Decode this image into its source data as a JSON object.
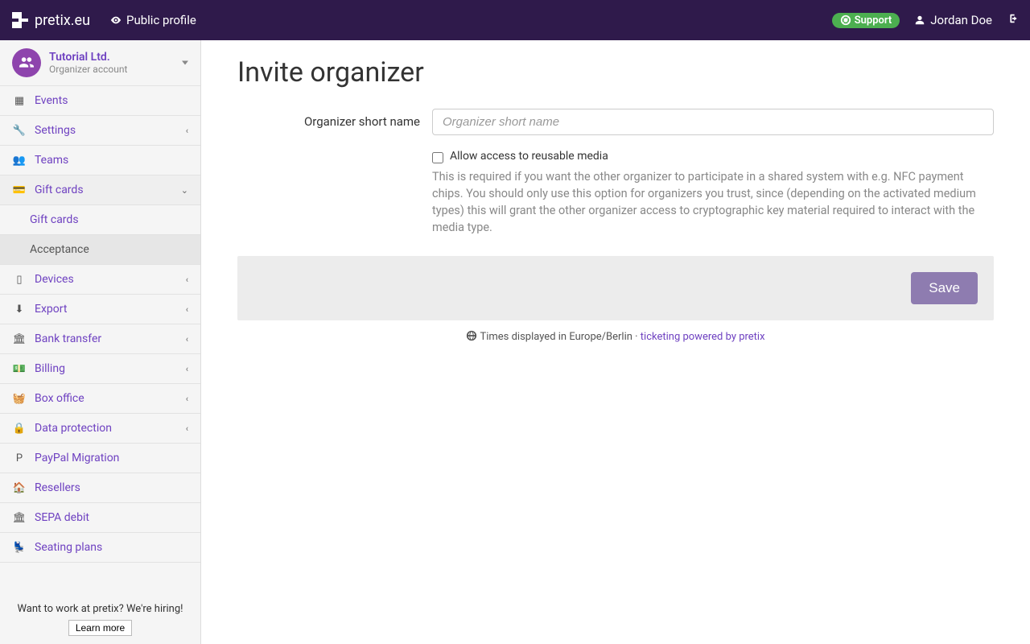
{
  "navbar": {
    "brand": "pretix.eu",
    "public_profile": "Public profile",
    "support": "Support",
    "user": "Jordan Doe"
  },
  "sidebar": {
    "org_name": "Tutorial Ltd.",
    "org_sub": "Organizer account",
    "items": [
      {
        "label": "Events",
        "icon": "calendar-icon",
        "expandable": false
      },
      {
        "label": "Settings",
        "icon": "wrench-icon",
        "expandable": true
      },
      {
        "label": "Teams",
        "icon": "users-icon",
        "expandable": false
      },
      {
        "label": "Gift cards",
        "icon": "card-icon",
        "expandable": true,
        "expanded": true,
        "children": [
          {
            "label": "Gift cards",
            "active": false
          },
          {
            "label": "Acceptance",
            "active": true
          }
        ]
      },
      {
        "label": "Devices",
        "icon": "tablet-icon",
        "expandable": true
      },
      {
        "label": "Export",
        "icon": "download-icon",
        "expandable": true
      },
      {
        "label": "Bank transfer",
        "icon": "bank-icon",
        "expandable": true
      },
      {
        "label": "Billing",
        "icon": "money-icon",
        "expandable": true
      },
      {
        "label": "Box office",
        "icon": "basket-icon",
        "expandable": true
      },
      {
        "label": "Data protection",
        "icon": "lock-icon",
        "expandable": true
      },
      {
        "label": "PayPal Migration",
        "icon": "paypal-icon",
        "expandable": false
      },
      {
        "label": "Resellers",
        "icon": "home-icon",
        "expandable": false
      },
      {
        "label": "SEPA debit",
        "icon": "bank-icon",
        "expandable": false
      },
      {
        "label": "Seating plans",
        "icon": "seat-icon",
        "expandable": false
      }
    ],
    "hiring": "Want to work at pretix? We're hiring!",
    "hiring_btn": "Learn more"
  },
  "main": {
    "title": "Invite organizer",
    "short_name_label": "Organizer short name",
    "short_name_placeholder": "Organizer short name",
    "short_name_value": "",
    "checkbox_label": "Allow access to reusable media",
    "checkbox_checked": false,
    "help_text": "This is required if you want the other organizer to participate in a shared system with e.g. NFC payment chips. You should only use this option for organizers you trust, since (depending on the activated medium types) this will grant the other organizer access to cryptographic key material required to interact with the media type.",
    "save": "Save"
  },
  "footer": {
    "tz_text": "Times displayed in Europe/Berlin",
    "separator": " · ",
    "powered": "ticketing powered by pretix"
  }
}
